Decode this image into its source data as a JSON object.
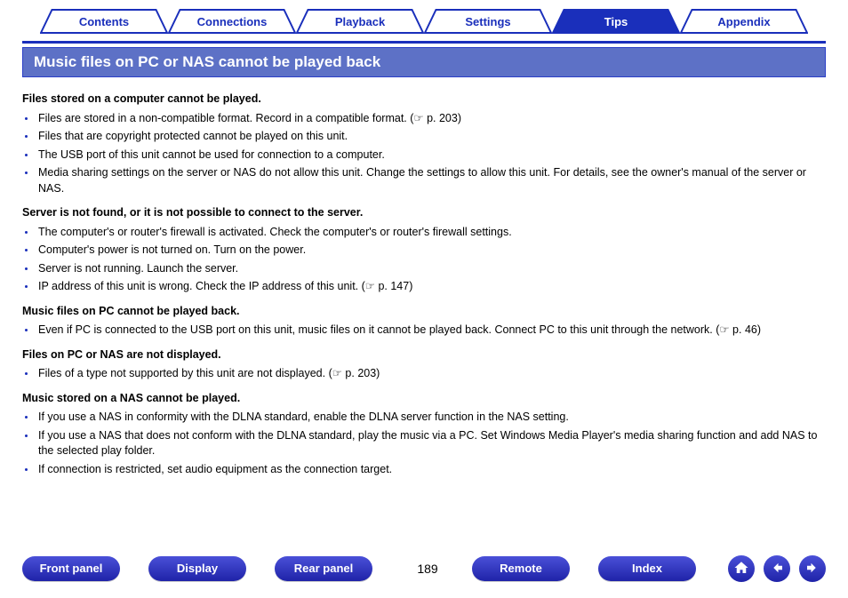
{
  "tabs": [
    {
      "label": "Contents",
      "active": false
    },
    {
      "label": "Connections",
      "active": false
    },
    {
      "label": "Playback",
      "active": false
    },
    {
      "label": "Settings",
      "active": false
    },
    {
      "label": "Tips",
      "active": true
    },
    {
      "label": "Appendix",
      "active": false
    }
  ],
  "title": "Music files on PC or NAS cannot be played back",
  "sections": [
    {
      "heading": "Files stored on a computer cannot be played.",
      "items": [
        "Files are stored in a non-compatible format. Record in a compatible format.  (☞ p. 203)",
        "Files that are copyright protected cannot be played on this unit.",
        "The USB port of this unit cannot be used for connection to a computer.",
        "Media sharing settings on the server or NAS do not allow this unit. Change the settings to allow this unit. For details, see the owner's manual of the server or NAS."
      ]
    },
    {
      "heading": "Server is not found, or it is not possible to connect to the server.",
      "items": [
        "The computer's or router's firewall is activated. Check the computer's or router's firewall settings.",
        "Computer's power is not turned on. Turn on the power.",
        "Server is not running. Launch the server.",
        "IP address of this unit is wrong. Check the IP address of this unit.  (☞ p. 147)"
      ]
    },
    {
      "heading": "Music files on PC cannot be played back.",
      "items": [
        "Even if PC is connected to the USB port on this unit, music files on it cannot be played back. Connect PC to this unit through the network.  (☞ p. 46)"
      ]
    },
    {
      "heading": "Files on PC or NAS are not displayed.",
      "items": [
        "Files of a type not supported by this unit are not displayed.  (☞ p. 203)"
      ]
    },
    {
      "heading": "Music stored on a NAS cannot be played.",
      "items": [
        "If you use a NAS in conformity with the DLNA standard, enable the DLNA server function in the NAS setting.",
        "If you use a NAS that does not conform with the DLNA standard, play the music via a PC. Set Windows Media Player's media sharing function and add NAS to the selected play folder.",
        "If connection is restricted, set audio equipment as the connection target."
      ]
    }
  ],
  "footer": {
    "buttons": [
      "Front panel",
      "Display",
      "Rear panel"
    ],
    "page": "189",
    "buttons2": [
      "Remote",
      "Index"
    ]
  },
  "nav_icons": {
    "home": "home-icon",
    "prev": "arrow-left-icon",
    "next": "arrow-right-icon"
  },
  "colors": {
    "accent": "#1a2fbb",
    "title_bg": "#5d71c6"
  }
}
